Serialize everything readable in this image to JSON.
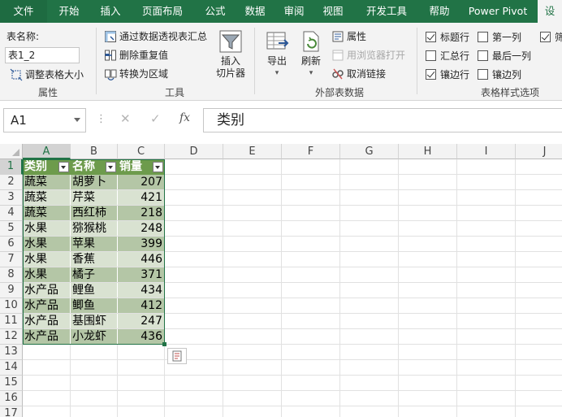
{
  "ribbon_tabs": [
    {
      "label": "文件",
      "state": "file"
    },
    {
      "label": "开始",
      "state": "normal"
    },
    {
      "label": "插入",
      "state": "normal"
    },
    {
      "label": "页面布局",
      "state": "normal"
    },
    {
      "label": "公式",
      "state": "normal"
    },
    {
      "label": "数据",
      "state": "normal"
    },
    {
      "label": "审阅",
      "state": "normal"
    },
    {
      "label": "视图",
      "state": "normal"
    },
    {
      "label": "开发工具",
      "state": "normal"
    },
    {
      "label": "帮助",
      "state": "normal"
    },
    {
      "label": "Power Pivot",
      "state": "normal"
    },
    {
      "label": "设",
      "state": "active"
    }
  ],
  "ribbon": {
    "properties": {
      "table_name_label": "表名称:",
      "table_name_value": "表1_2",
      "resize_label": "调整表格大小",
      "group_label": "属性"
    },
    "tools": {
      "pivot_label": "通过数据透视表汇总",
      "remove_dup_label": "删除重复值",
      "convert_label": "转换为区域",
      "slicer_line1": "插入",
      "slicer_line2": "切片器",
      "group_label": "工具"
    },
    "external": {
      "export_label": "导出",
      "refresh_label": "刷新",
      "properties_label": "属性",
      "open_browser_label": "用浏览器打开",
      "unlink_label": "取消链接",
      "group_label": "外部表数据"
    },
    "style_options": {
      "header_row": {
        "label": "标题行",
        "checked": true
      },
      "total_row": {
        "label": "汇总行",
        "checked": false
      },
      "banded_rows": {
        "label": "镶边行",
        "checked": true
      },
      "first_column": {
        "label": "第一列",
        "checked": false
      },
      "last_column": {
        "label": "最后一列",
        "checked": false
      },
      "banded_columns": {
        "label": "镶边列",
        "checked": false
      },
      "filter_button": {
        "label": "筛",
        "checked": true
      },
      "group_label": "表格样式选项"
    }
  },
  "formula_bar": {
    "name_box": "A1",
    "cancel_glyph": "✕",
    "enter_glyph": "✓",
    "fx_glyph": "fx",
    "content": "类别"
  },
  "sheet": {
    "columns": [
      "A",
      "B",
      "C",
      "D",
      "E",
      "F",
      "G",
      "H",
      "I",
      "J"
    ],
    "selected_column": "A",
    "rows": [
      "1",
      "2",
      "3",
      "4",
      "5",
      "6",
      "7",
      "8",
      "9",
      "10",
      "11",
      "12",
      "13",
      "14",
      "15",
      "16",
      "17"
    ],
    "selected_row": "1",
    "table": {
      "headers": [
        "类别",
        "名称",
        "销量"
      ],
      "rows": [
        [
          "蔬菜",
          "胡萝卜",
          "207"
        ],
        [
          "蔬菜",
          "芹菜",
          "421"
        ],
        [
          "蔬菜",
          "西红柿",
          "218"
        ],
        [
          "水果",
          "猕猴桃",
          "248"
        ],
        [
          "水果",
          "苹果",
          "399"
        ],
        [
          "水果",
          "香蕉",
          "446"
        ],
        [
          "水果",
          "橘子",
          "371"
        ],
        [
          "水产品",
          "鲤鱼",
          "434"
        ],
        [
          "水产品",
          "鲫鱼",
          "412"
        ],
        [
          "水产品",
          "基围虾",
          "247"
        ],
        [
          "水产品",
          "小龙虾",
          "436"
        ]
      ]
    }
  },
  "colors": {
    "excel_green": "#217346",
    "table_header": "#6d9b4c",
    "band_dark": "#b4c6a6",
    "band_light": "#d9e2d1"
  }
}
